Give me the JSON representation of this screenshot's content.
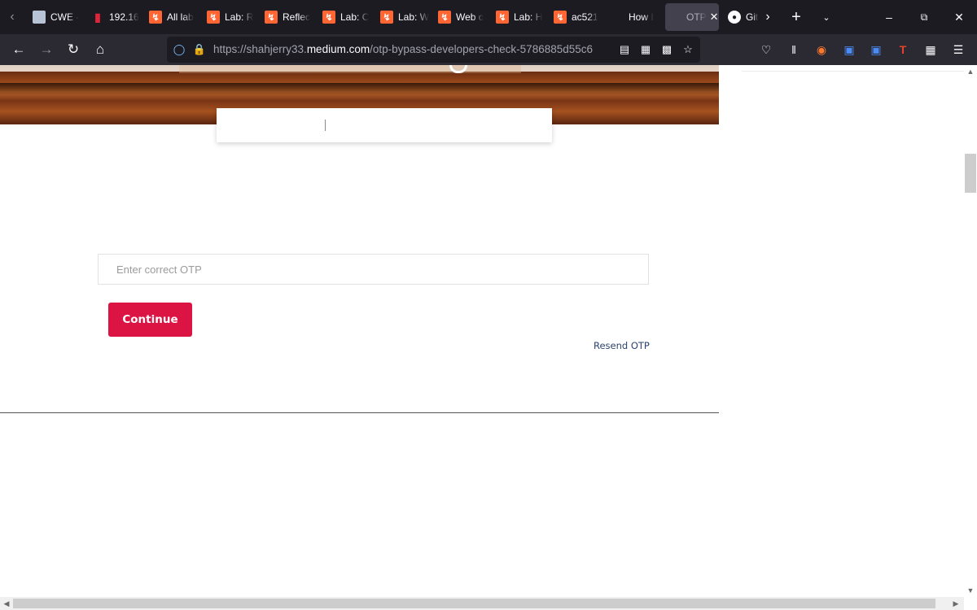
{
  "browser": {
    "tabs": [
      {
        "label": "CWE -",
        "favicon": "cwe-favicon"
      },
      {
        "label": "192.16",
        "favicon": "thermometer-favicon"
      },
      {
        "label": "All lab",
        "favicon": "portswigger-favicon"
      },
      {
        "label": "Lab: R",
        "favicon": "portswigger-favicon"
      },
      {
        "label": "Reflec",
        "favicon": "portswigger-favicon"
      },
      {
        "label": "Lab: C",
        "favicon": "portswigger-favicon"
      },
      {
        "label": "Lab: W",
        "favicon": "portswigger-favicon"
      },
      {
        "label": "Web c",
        "favicon": "portswigger-favicon"
      },
      {
        "label": "Lab: H",
        "favicon": "portswigger-favicon"
      },
      {
        "label": "ac521",
        "favicon": "portswigger-favicon"
      },
      {
        "label": "How I",
        "favicon": "none"
      },
      {
        "label": "OTP",
        "favicon": "none",
        "active": true
      },
      {
        "label": "Git",
        "favicon": "github-favicon"
      }
    ],
    "url": {
      "prefix": "https://shahjerry33.",
      "host": "medium.com",
      "path": "/otp-bypass-developers-check-5786885d55c6"
    }
  },
  "page": {
    "otp_input": {
      "placeholder": "Enter correct OTP",
      "value": ""
    },
    "continue_label": "Continue",
    "resend_label": "Resend OTP"
  },
  "colors": {
    "accent_button": "#dc1443",
    "link": "#2d4470",
    "tabbar_bg": "#1c1b22",
    "toolbar_bg": "#2b2a33"
  }
}
